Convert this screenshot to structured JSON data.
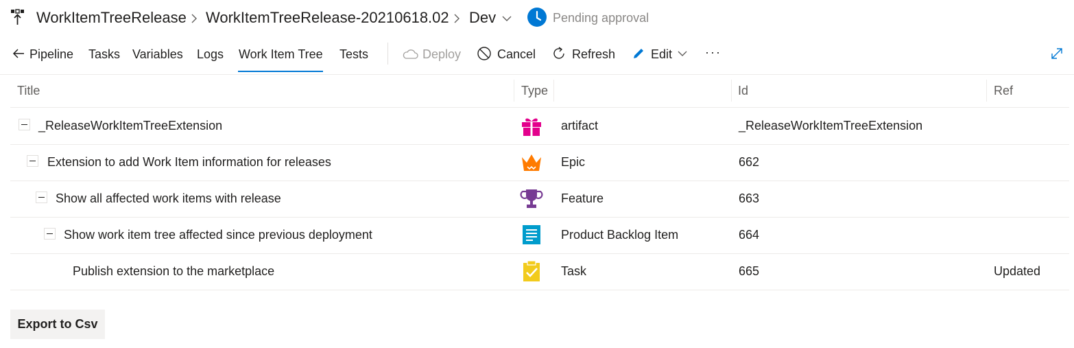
{
  "breadcrumb": {
    "pipeline": "WorkItemTreeRelease",
    "release": "WorkItemTreeRelease-20210618.02",
    "stage": "Dev",
    "status": "Pending approval"
  },
  "toolbar": {
    "back_label": "Pipeline",
    "tabs": [
      "Tasks",
      "Variables",
      "Logs",
      "Work Item Tree",
      "Tests"
    ],
    "active_tab": "Work Item Tree",
    "deploy_label": "Deploy",
    "cancel_label": "Cancel",
    "refresh_label": "Refresh",
    "edit_label": "Edit",
    "more_label": "···"
  },
  "table": {
    "headers": {
      "title": "Title",
      "type": "Type",
      "id": "Id",
      "ref": "Ref"
    },
    "rows": [
      {
        "title": "_ReleaseWorkItemTreeExtension",
        "type": "artifact",
        "id": "_ReleaseWorkItemTreeExtension",
        "ref": "",
        "icon": "gift-icon",
        "color": "#e3008c"
      },
      {
        "title": "Extension to add Work Item information for releases",
        "type": "Epic",
        "id": "662",
        "ref": "",
        "icon": "crown-icon",
        "color": "#ff7b00"
      },
      {
        "title": "Show all affected work items with release",
        "type": "Feature",
        "id": "663",
        "ref": "",
        "icon": "trophy-icon",
        "color": "#773b93"
      },
      {
        "title": "Show work item tree affected since previous deployment",
        "type": "Product Backlog Item",
        "id": "664",
        "ref": "",
        "icon": "list-icon",
        "color": "#009ccc"
      },
      {
        "title": "Publish extension to the marketplace",
        "type": "Task",
        "id": "665",
        "ref": "Updated",
        "icon": "clipboard-check-icon",
        "color": "#f2cb1d"
      }
    ]
  },
  "export_label": "Export to Csv",
  "colors": {
    "accent": "#0078d4",
    "status": "#0078d4"
  }
}
